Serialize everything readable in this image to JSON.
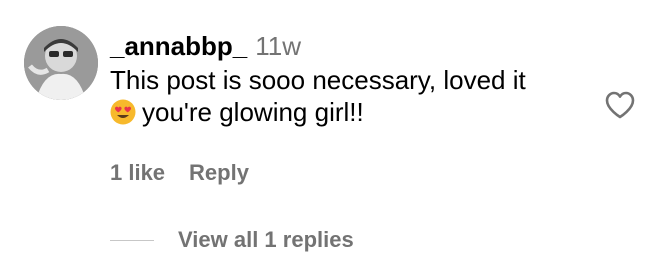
{
  "comment": {
    "username": "_annabbp_",
    "timestamp": "11w",
    "text_line1": "This post is sooo necessary, loved it",
    "text_line2": "you're glowing girl!!",
    "emoji": "heart-eyes-emoji"
  },
  "actions": {
    "likes": "1 like",
    "reply": "Reply"
  },
  "replies": {
    "view_all": "View all 1 replies"
  },
  "icons": {
    "avatar": "profile-photo",
    "like": "heart-outline-icon"
  },
  "colors": {
    "text": "#000000",
    "secondary": "#737373",
    "divider": "#c7c7c7"
  }
}
